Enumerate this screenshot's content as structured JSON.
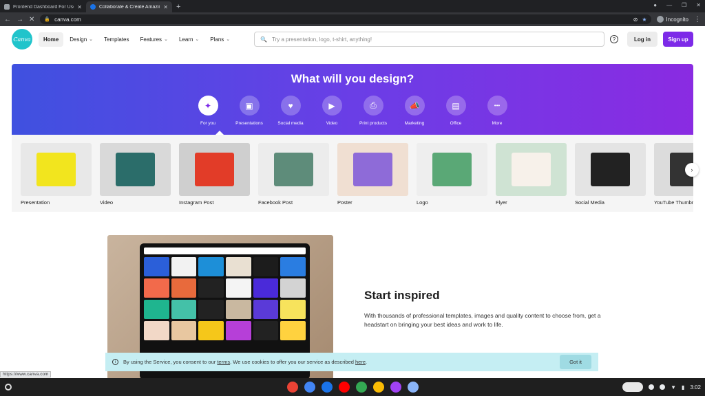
{
  "browser": {
    "tabs": [
      {
        "title": "Frontend Dashboard For Users",
        "active": false
      },
      {
        "title": "Collaborate & Create Amazing G",
        "active": true
      }
    ],
    "new_tab": "+",
    "url": "canva.com",
    "profile": "Incognito",
    "status_url": "https://www.canva.com"
  },
  "header": {
    "logo": "Canva",
    "nav": [
      {
        "label": "Home",
        "active": true,
        "dropdown": false
      },
      {
        "label": "Design",
        "dropdown": true
      },
      {
        "label": "Templates",
        "dropdown": false
      },
      {
        "label": "Features",
        "dropdown": true
      },
      {
        "label": "Learn",
        "dropdown": true
      },
      {
        "label": "Plans",
        "dropdown": true
      }
    ],
    "search_placeholder": "Try a presentation, logo, t-shirt, anything!",
    "help": "?",
    "login": "Log in",
    "signup": "Sign up"
  },
  "hero": {
    "title": "What will you design?",
    "categories": [
      {
        "label": "For you",
        "icon": "sparkle-icon",
        "glyph": "✦",
        "selected": true
      },
      {
        "label": "Presentations",
        "icon": "presentation-icon",
        "glyph": "▣"
      },
      {
        "label": "Social media",
        "icon": "heart-icon",
        "glyph": "♥"
      },
      {
        "label": "Video",
        "icon": "video-icon",
        "glyph": "▶"
      },
      {
        "label": "Print products",
        "icon": "printer-icon",
        "glyph": "⎙"
      },
      {
        "label": "Marketing",
        "icon": "megaphone-icon",
        "glyph": "📣"
      },
      {
        "label": "Office",
        "icon": "briefcase-icon",
        "glyph": "▤"
      },
      {
        "label": "More",
        "icon": "more-icon",
        "glyph": "•••"
      }
    ]
  },
  "design_types": [
    {
      "label": "Presentation",
      "bg": "#e8e8e8",
      "accent": "#f2e51e"
    },
    {
      "label": "Video",
      "bg": "#d9d9d9",
      "accent": "#2b6d6a"
    },
    {
      "label": "Instagram Post",
      "bg": "#cfcfcf",
      "accent": "#e23c28"
    },
    {
      "label": "Facebook Post",
      "bg": "#ececec",
      "accent": "#5e8c7a"
    },
    {
      "label": "Poster",
      "bg": "#f0dfd2",
      "accent": "#8e6bd8"
    },
    {
      "label": "Logo",
      "bg": "#eeeeee",
      "accent": "#5aa876"
    },
    {
      "label": "Flyer",
      "bg": "#cfe3d3",
      "accent": "#f7f1ea"
    },
    {
      "label": "Social Media",
      "bg": "#e4e4e4",
      "accent": "#222222"
    },
    {
      "label": "YouTube Thumbnail",
      "bg": "#dcdcdc",
      "accent": "#333333"
    }
  ],
  "inspired": {
    "title": "Start inspired",
    "body": "With thousands of professional templates, images and quality content to choose from, get a headstart on bringing your best ideas and work to life."
  },
  "cookie": {
    "prefix": "By using the Service, you consent to our",
    "terms": "terms",
    "middle": ". We use cookies to offer you our service as described",
    "here": "here",
    "suffix": ".",
    "button": "Got it"
  },
  "shelf": {
    "time": "3:02",
    "apps": [
      "#ea4335",
      "#4285f4",
      "#1a73e8",
      "#ff0000",
      "#34a853",
      "#fbbc04",
      "#a142f4",
      "#8ab4f8"
    ]
  },
  "colors": {
    "brand": "#7d2ae8",
    "logo": "#20c4cb",
    "cookie_bg": "#c5eef3"
  }
}
